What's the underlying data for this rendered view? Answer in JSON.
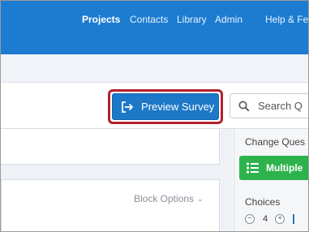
{
  "nav": {
    "items": [
      {
        "label": "Projects",
        "active": true
      },
      {
        "label": "Contacts",
        "active": false
      },
      {
        "label": "Library",
        "active": false
      },
      {
        "label": "Admin",
        "active": false
      },
      {
        "label": "Help & Fe",
        "active": false
      }
    ]
  },
  "toolbar": {
    "preview_label": "Preview Survey",
    "preview_icon": "preview-arrow-icon",
    "search_label": "Search Q",
    "search_icon": "search-icon"
  },
  "block": {
    "options_label": "Block Options",
    "options_icon": "chevron-down-icon"
  },
  "right_panel": {
    "title": "Change Ques",
    "question_type_label": "Multiple",
    "question_type_icon": "multiple-choice-icon",
    "choices_label": "Choices",
    "choices_value": "4"
  },
  "colors": {
    "nav_bg": "#1c7cd1",
    "primary": "#1d78c8",
    "highlight": "#b3202e",
    "question_type": "#2eb24e"
  }
}
